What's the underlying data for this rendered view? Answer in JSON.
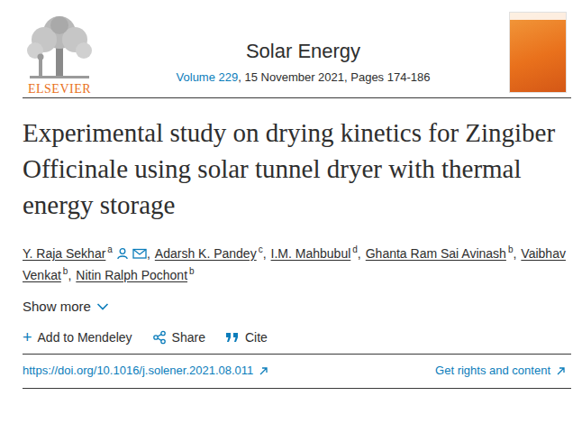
{
  "logo": {
    "wordmark": "ELSEVIER"
  },
  "journal": {
    "title": "Solar Energy",
    "volume": "Volume 229",
    "details": ", 15 November 2021, Pages 174-186"
  },
  "article": {
    "title": "Experimental study on drying kinetics for Zingiber Officinale using solar tunnel dryer with thermal energy storage",
    "authors": [
      {
        "name": "Y. Raja Sekhar",
        "affiliation": "a",
        "corresponding": true,
        "separator": ","
      },
      {
        "name": "Adarsh K. Pandey",
        "affiliation": "c",
        "corresponding": false,
        "separator": ","
      },
      {
        "name": "I.M. Mahbubul",
        "affiliation": "d",
        "corresponding": false,
        "separator": ","
      },
      {
        "name": "Ghanta Ram Sai Avinash",
        "affiliation": "b",
        "corresponding": false,
        "separator": ","
      },
      {
        "name": "Vaibhav Venkat",
        "affiliation": "b",
        "corresponding": false,
        "separator": ","
      },
      {
        "name": "Nitin Ralph Pochont",
        "affiliation": "b",
        "corresponding": false,
        "separator": ""
      }
    ]
  },
  "show_more": {
    "label": "Show more",
    "expanded": false
  },
  "actions": [
    {
      "label": "Add to Mendeley",
      "icon": "+",
      "kind": "mendeley"
    },
    {
      "label": "Share",
      "icon": "",
      "kind": "share"
    },
    {
      "label": "Cite",
      "icon": "",
      "kind": "cite"
    }
  ],
  "links": {
    "doi": "https://doi.org/10.1016/j.solener.2021.08.011",
    "rights": "Get rights and content"
  }
}
